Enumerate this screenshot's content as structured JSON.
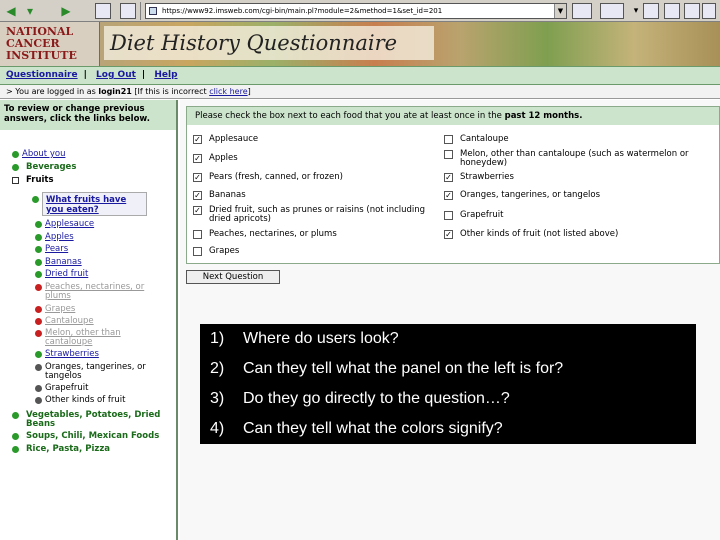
{
  "browser": {
    "address": "https://www92.imsweb.com/cgi-bin/main.pl?module=2&method=1&set_id=201"
  },
  "banner": {
    "logo_text": "NATIONAL CANCER INSTITUTE",
    "title": "Diet History Questionnaire"
  },
  "nav": {
    "questionnaire": "Questionnaire",
    "logout": "Log Out",
    "help": "Help",
    "sep": "|"
  },
  "login": {
    "prefix": "> You are logged in as ",
    "user": "login21",
    "middle": " [If this is incorrect ",
    "link": "click here",
    "suffix": "]"
  },
  "sidebar": {
    "heading": "To review or change previous answers, click the links below.",
    "items": [
      {
        "label": "About you"
      },
      {
        "label": "Beverages"
      },
      {
        "label": "Fruits"
      },
      {
        "label": "What fruits have you eaten?"
      },
      {
        "label": "Applesauce"
      },
      {
        "label": "Apples"
      },
      {
        "label": "Pears"
      },
      {
        "label": "Bananas"
      },
      {
        "label": "Dried fruit"
      },
      {
        "label": "Peaches, nectarines, or plums"
      },
      {
        "label": "Grapes"
      },
      {
        "label": "Cantaloupe"
      },
      {
        "label": "Melon, other than cantaloupe"
      },
      {
        "label": "Strawberries"
      },
      {
        "label": "Oranges, tangerines, or tangelos"
      },
      {
        "label": "Grapefruit"
      },
      {
        "label": "Other kinds of fruit"
      },
      {
        "label": "Vegetables, Potatoes, Dried Beans"
      },
      {
        "label": "Soups, Chili, Mexican Foods"
      },
      {
        "label": "Rice, Pasta, Pizza"
      }
    ]
  },
  "question": {
    "text_before": "Please check the box next to each food that you ate at least once in the ",
    "text_bold": "past 12 months.",
    "left_options": [
      {
        "label": "Applesauce",
        "checked": true
      },
      {
        "label": "Apples",
        "checked": true
      },
      {
        "label": "Pears (fresh, canned, or frozen)",
        "checked": true
      },
      {
        "label": "Bananas",
        "checked": true
      },
      {
        "label": "Dried fruit, such as prunes or raisins (not including dried apricots)",
        "checked": true
      },
      {
        "label": "Peaches, nectarines, or plums",
        "checked": false
      },
      {
        "label": "Grapes",
        "checked": false
      }
    ],
    "right_options": [
      {
        "label": "Cantaloupe",
        "checked": false
      },
      {
        "label": "Melon, other than cantaloupe (such as watermelon or honeydew)",
        "checked": false
      },
      {
        "label": "Strawberries",
        "checked": true
      },
      {
        "label": "Oranges, tangerines, or tangelos",
        "checked": true
      },
      {
        "label": "Grapefruit",
        "checked": false
      },
      {
        "label": "Other kinds of fruit (not listed above)",
        "checked": true
      }
    ],
    "next_button": "Next Question"
  },
  "overlay": {
    "items": [
      {
        "num": "1)",
        "text": "Where do users look?"
      },
      {
        "num": "2)",
        "text": "Can they tell what the panel on the left is for?"
      },
      {
        "num": "3)",
        "text": "Do they go directly to the question…?"
      },
      {
        "num": "4)",
        "text": "Can they tell what the colors signify?"
      }
    ]
  },
  "colors": {
    "answered": "#2a9a2a",
    "unanswered": "#c82020",
    "nav_bg": "#cce4cc"
  }
}
